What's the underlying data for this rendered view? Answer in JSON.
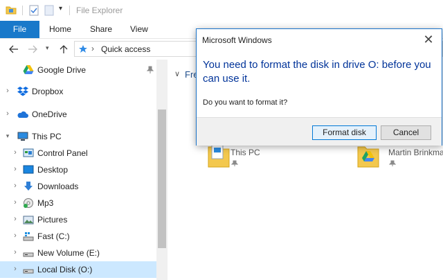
{
  "window": {
    "title": "File Explorer"
  },
  "ribbon": {
    "tabs": [
      "File",
      "Home",
      "Share",
      "View"
    ]
  },
  "address": {
    "path": "Quick access"
  },
  "nav": {
    "items": [
      {
        "label": "Google Drive"
      },
      {
        "label": "Dropbox"
      },
      {
        "label": "OneDrive"
      },
      {
        "label": "This PC"
      },
      {
        "label": "Control Panel"
      },
      {
        "label": "Desktop"
      },
      {
        "label": "Downloads"
      },
      {
        "label": "Mp3"
      },
      {
        "label": "Pictures"
      },
      {
        "label": "Fast (C:)"
      },
      {
        "label": "New Volume (E:)"
      },
      {
        "label": "Local Disk (O:)"
      }
    ]
  },
  "content": {
    "group_label": "Fre",
    "tiles": [
      {
        "label": "This PC"
      },
      {
        "label": "Martin Brinkma"
      }
    ]
  },
  "dialog": {
    "title": "Microsoft Windows",
    "close": "✕",
    "heading": "You need to format the disk in drive O: before you can use it.",
    "question": "Do you want to format it?",
    "format_label": "Format disk",
    "cancel_label": "Cancel"
  },
  "colors": {
    "accent": "#1979ca",
    "heading": "#003399",
    "selected": "#cce8ff"
  }
}
